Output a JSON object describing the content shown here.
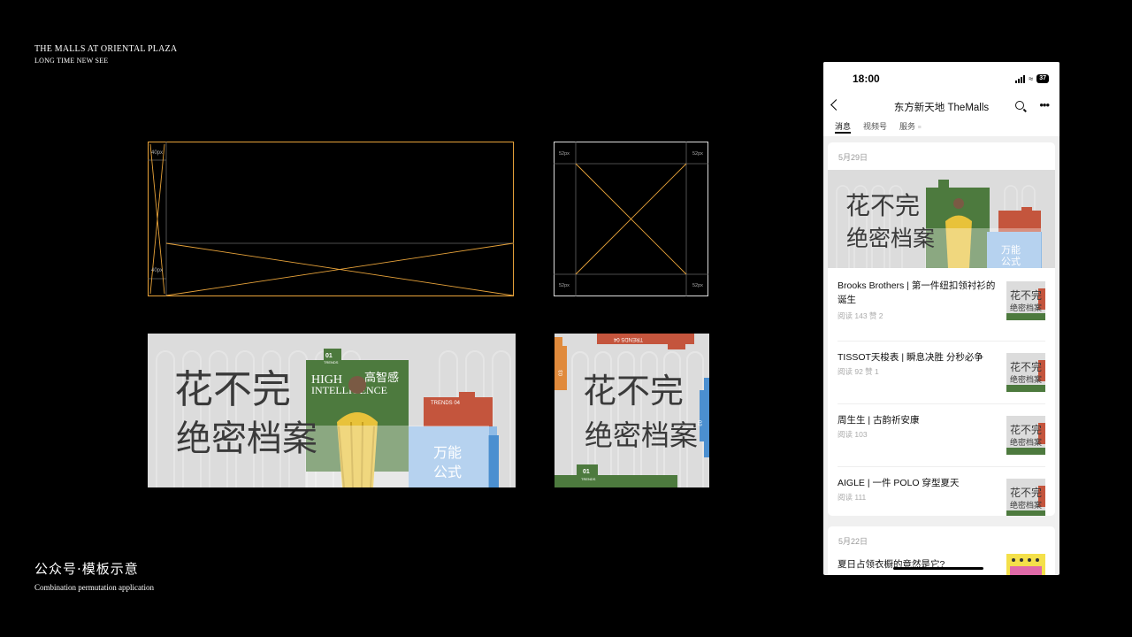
{
  "brand": {
    "line1": "THE MALLS AT ORIENTAL PLAZA",
    "line2": "LONG TIME NEW SEE"
  },
  "caption": {
    "title": "公众号·模板示意",
    "subtitle": "Combination permutation application"
  },
  "wireframes": {
    "wide": {
      "top_label": "40px",
      "bottom_label": "40px"
    },
    "square": {
      "labels": [
        "52px",
        "52px",
        "52px",
        "52px"
      ]
    }
  },
  "banner": {
    "headline_line1": "花不完",
    "headline_line2": "绝密档案",
    "tag_01_num": "01",
    "tag_01_text": "TRENDS",
    "green_title_cn": "高智感",
    "green_title_en1": "HIGH",
    "green_title_en2": "INTELLIGENCE",
    "red_tag": "TRENDS 04",
    "blue_text1": "万能",
    "blue_text2": "公式",
    "square_top_tag": "TRENDS 04",
    "square_left_tag": "03",
    "square_right_tag": "02"
  },
  "colors": {
    "green": "#4d7a3e",
    "red": "#c4553d",
    "blue": "#4b8fd0",
    "orange": "#e08a3c",
    "wire": "#e8a33a"
  },
  "phone": {
    "time": "18:00",
    "battery": "37",
    "title": "东方新天地 TheMalls",
    "tabs": [
      "消息",
      "视频号",
      "服务"
    ],
    "card1": {
      "date": "5月29日",
      "articles": [
        {
          "title": "Brooks Brothers | 第一件纽扣领衬衫的诞生",
          "meta": "阅读 143   赞 2"
        },
        {
          "title": "TISSOT天梭表 | 瞬息决胜 分秒必争",
          "meta": "阅读 92   赞 1"
        },
        {
          "title": "周生生 | 古韵祈安康",
          "meta": "阅读 103"
        },
        {
          "title": "AIGLE | 一件 POLO 穿型夏天",
          "meta": "阅读 111"
        }
      ]
    },
    "card2": {
      "date": "5月22日",
      "first_title": "夏日占领衣橱的竟然是它?"
    }
  }
}
